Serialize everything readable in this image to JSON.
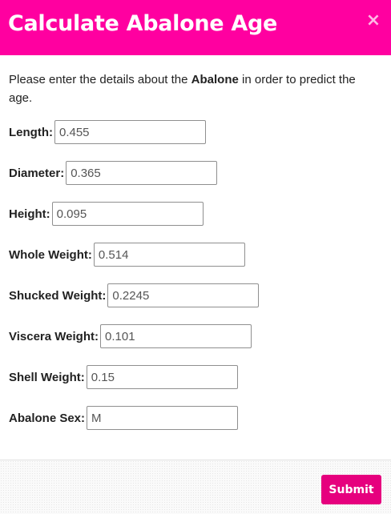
{
  "modal": {
    "title": "Calculate Abalone Age",
    "close_label": "×"
  },
  "intro": {
    "text_before": "Please enter the details about the ",
    "emphasis": "Abalone",
    "text_after": " in order to predict the age."
  },
  "fields": [
    {
      "label": "Length:",
      "value": "0.455"
    },
    {
      "label": "Diameter:",
      "value": "0.365"
    },
    {
      "label": "Height:",
      "value": "0.095"
    },
    {
      "label": "Whole Weight:",
      "value": "0.514"
    },
    {
      "label": "Shucked Weight:",
      "value": "0.2245"
    },
    {
      "label": "Viscera Weight:",
      "value": "0.101"
    },
    {
      "label": "Shell Weight:",
      "value": "0.15"
    },
    {
      "label": "Abalone Sex:",
      "value": "M"
    }
  ],
  "footer": {
    "submit_label": "Submit"
  },
  "colors": {
    "header_bg": "#ff00a0",
    "submit_bg": "#e6007e"
  }
}
